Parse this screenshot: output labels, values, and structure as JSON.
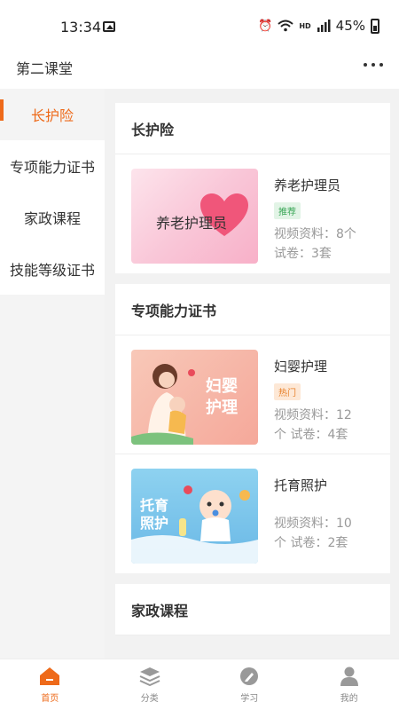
{
  "status_bar": {
    "time": "13:34",
    "battery": "45%",
    "icons": [
      "image-icon",
      "alarm-icon",
      "wifi-icon",
      "hd-icon",
      "4g-signal-icon",
      "battery-icon"
    ]
  },
  "app": {
    "title": "第二课堂",
    "more_icon": "more-dots-icon"
  },
  "sidebar": {
    "items": [
      {
        "label": "长护险",
        "active": true
      },
      {
        "label": "专项能力证书",
        "active": false
      },
      {
        "label": "家政课程",
        "active": false
      },
      {
        "label": "技能等级证书",
        "active": false
      }
    ]
  },
  "sections": [
    {
      "title": "长护险",
      "courses": [
        {
          "name": "养老护理员",
          "badge": "推荐",
          "thumb_text": "养老护理员",
          "video_line": "视频资料：8个",
          "paper_line": "试卷：3套"
        }
      ]
    },
    {
      "title": "专项能力证书",
      "courses": [
        {
          "name": "妇婴护理",
          "badge": "热门",
          "thumb_text_1": "妇婴",
          "thumb_text_2": "护理",
          "video_line": "视频资料：12",
          "paper_line": "个  试卷：4套"
        },
        {
          "name": "托育照护",
          "thumb_text_1": "托育",
          "thumb_text_2": "照护",
          "video_line": "视频资料：10",
          "paper_line": "个  试卷：2套"
        }
      ]
    },
    {
      "title": "家政课程",
      "courses": []
    }
  ],
  "tabbar": {
    "items": [
      {
        "label": "首页",
        "icon": "home-icon",
        "active": true
      },
      {
        "label": "分类",
        "icon": "layers-icon",
        "active": false
      },
      {
        "label": "学习",
        "icon": "pen-circle-icon",
        "active": false
      },
      {
        "label": "我的",
        "icon": "user-icon",
        "active": false
      }
    ]
  },
  "colors": {
    "accent": "#ee6a1a",
    "recommend_badge": "#3aa657",
    "hot_badge": "#e8812a"
  }
}
